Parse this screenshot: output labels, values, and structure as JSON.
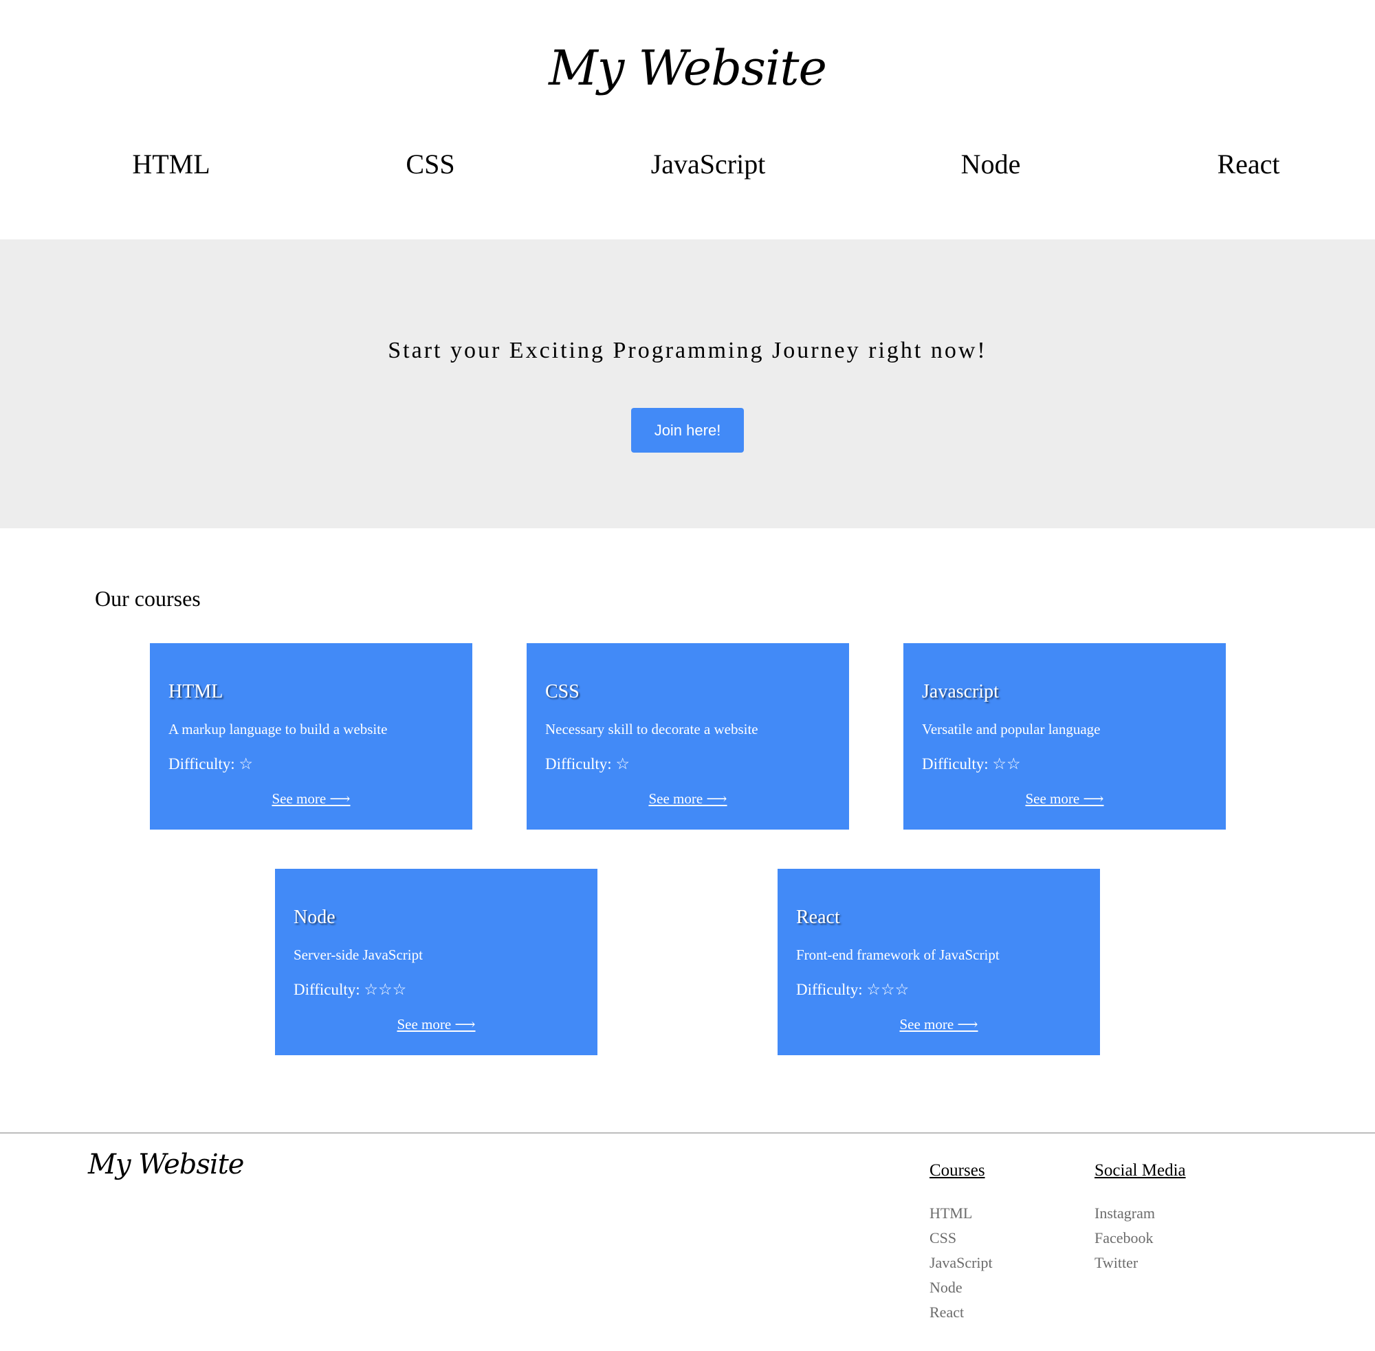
{
  "header": {
    "title": "My Website",
    "nav": [
      "HTML",
      "CSS",
      "JavaScript",
      "Node",
      "React"
    ]
  },
  "hero": {
    "tagline": "Start your Exciting Programming Journey right now!",
    "cta_label": "Join here!"
  },
  "courses": {
    "heading": "Our courses",
    "cards": [
      {
        "title": "HTML",
        "description": "A markup language to build a website",
        "difficulty_label": "Difficulty:",
        "stars": "☆",
        "difficulty_stars": 1,
        "link": "See more ⟶"
      },
      {
        "title": "CSS",
        "description": "Necessary skill to decorate a website",
        "difficulty_label": "Difficulty:",
        "stars": "☆",
        "difficulty_stars": 1,
        "link": "See more ⟶"
      },
      {
        "title": "Javascript",
        "description": "Versatile and popular language",
        "difficulty_label": "Difficulty:",
        "stars": "☆☆",
        "difficulty_stars": 2,
        "link": "See more ⟶"
      },
      {
        "title": "Node",
        "description": "Server-side JavaScript",
        "difficulty_label": "Difficulty:",
        "stars": "☆☆☆",
        "difficulty_stars": 3,
        "link": "See more ⟶"
      },
      {
        "title": "React",
        "description": "Front-end framework of JavaScript",
        "difficulty_label": "Difficulty:",
        "stars": "☆☆☆",
        "difficulty_stars": 3,
        "link": "See more ⟶"
      }
    ]
  },
  "footer": {
    "logo": "My Website",
    "columns": [
      {
        "title": "Courses",
        "links": [
          "HTML",
          "CSS",
          "JavaScript",
          "Node",
          "React"
        ]
      },
      {
        "title": "Social Media",
        "links": [
          "Instagram",
          "Facebook",
          "Twitter"
        ]
      }
    ]
  },
  "colors": {
    "accent": "#428af7",
    "hero_bg": "#ededed",
    "footer_link": "#6b6b6b"
  }
}
